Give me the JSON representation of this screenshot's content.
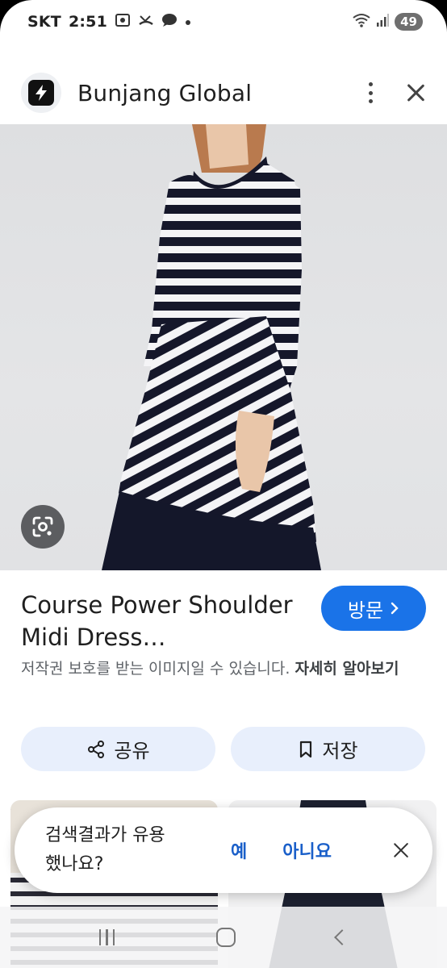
{
  "status_bar": {
    "carrier": "SKT",
    "time": "2:51",
    "battery": "49"
  },
  "header": {
    "app_name": "Bunjang Global"
  },
  "result": {
    "title": "Course Power Shoulder Midi Dress…",
    "visit_label": "방문",
    "copyright_notice": "저작권 보호를 받는 이미지일 수 있습니다.",
    "learn_more": "자세히 알아보기",
    "share_label": "공유",
    "save_label": "저장"
  },
  "feedback": {
    "question": "검색결과가 유용했나요?",
    "yes": "예",
    "no": "아니요"
  },
  "colors": {
    "accent": "#1a73e8",
    "action_bg": "#e8effc",
    "link": "#1a5fc9"
  }
}
